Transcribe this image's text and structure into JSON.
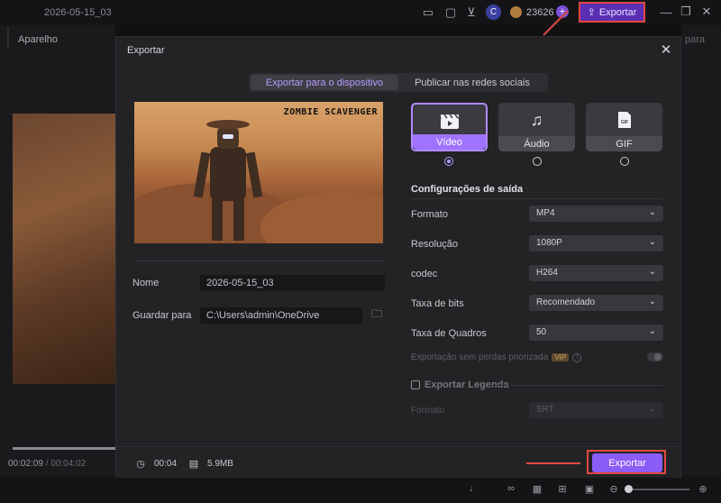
{
  "titlebar": {
    "project_name": "2026-05-15_03",
    "avatar_letter": "C",
    "credits": "23626",
    "plus": "+",
    "export_label": "Exportar"
  },
  "sidebar": {
    "tab_label": "Aparelho"
  },
  "player": {
    "current_time": "00:02:09",
    "separator": "/",
    "total_time": "00:04:02",
    "progress_fraction": 1.0
  },
  "right_panel": {
    "label": "para"
  },
  "dialog": {
    "title": "Exportar",
    "tabs": [
      {
        "label": "Exportar para o dispositivo",
        "active": true
      },
      {
        "label": "Publicar nas redes sociais",
        "active": false
      }
    ],
    "preview_watermark": "ZOMBIE SCAVENGER",
    "name_label": "Nome",
    "name_value": "2026-05-15_03",
    "save_label": "Guardar para",
    "save_value": "C:\\Users\\admin\\OneDrive",
    "formats": [
      {
        "label": "Vídeo",
        "icon": "clapperboard-icon",
        "selected": true
      },
      {
        "label": "Áudio",
        "icon": "music-note-icon",
        "selected": false
      },
      {
        "label": "GIF",
        "icon": "gif-file-icon",
        "selected": false
      }
    ],
    "output_settings_title": "Configurações de saída",
    "options": [
      {
        "label": "Formato",
        "value": "MP4"
      },
      {
        "label": "Resolução",
        "value": "1080P"
      },
      {
        "label": "codec",
        "value": "H264"
      },
      {
        "label": "Taxa de bits",
        "value": "Recomendado"
      },
      {
        "label": "Taxa de Quadros",
        "value": "50"
      }
    ],
    "lossless_label": "Exportação sem perdas priorizada",
    "vip_badge": "VIP",
    "lossless_enabled": false,
    "subtitle_export_label": "Exportar Legenda",
    "subtitle_export_checked": false,
    "subtitle_format_label": "Formato",
    "subtitle_format_value": "SRT",
    "duration": "00:04",
    "file_size": "5.9MB",
    "export_button": "Exportar"
  },
  "colors": {
    "accent": "#8b5cf6",
    "accent_text": "#b69bff",
    "annotation": "#e0483f"
  }
}
